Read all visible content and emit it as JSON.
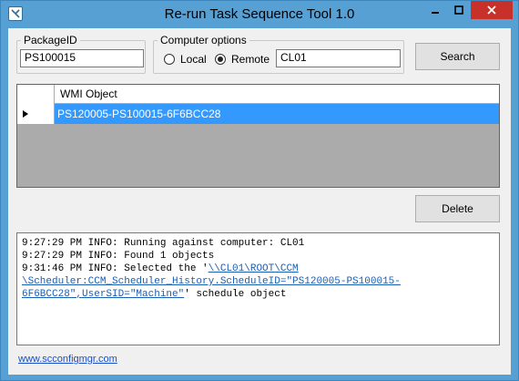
{
  "window": {
    "title": "Re-run Task Sequence Tool 1.0"
  },
  "package_group": {
    "legend": "PackageID",
    "value": "PS100015"
  },
  "computer_group": {
    "legend": "Computer options",
    "local_label": "Local",
    "remote_label": "Remote",
    "selected": "Remote",
    "computer_value": "CL01"
  },
  "search_label": "Search",
  "delete_label": "Delete",
  "grid": {
    "column": "WMI Object",
    "rows": [
      {
        "value": "PS120005-PS100015-6F6BCC28",
        "selected": true
      }
    ]
  },
  "log": {
    "line1": "9:27:29 PM INFO: Running against computer: CL01",
    "line2": "9:27:29 PM INFO: Found 1 objects",
    "line3_prefix": "9:31:46 PM INFO: Selected the '",
    "line3_link1": "\\\\CL01\\ROOT\\CCM",
    "line4_link": "\\Scheduler:CCM_Scheduler_History.ScheduleID=\"PS120005-PS100015-",
    "line5_link": "6F6BCC28\",UserSID=\"Machine\"",
    "line5_suffix": "' schedule object"
  },
  "footer_link": "www.scconfigmgr.com",
  "colors": {
    "titlebar": "#56a0d3",
    "selection": "#3399ff",
    "close_button": "#c7312a"
  }
}
